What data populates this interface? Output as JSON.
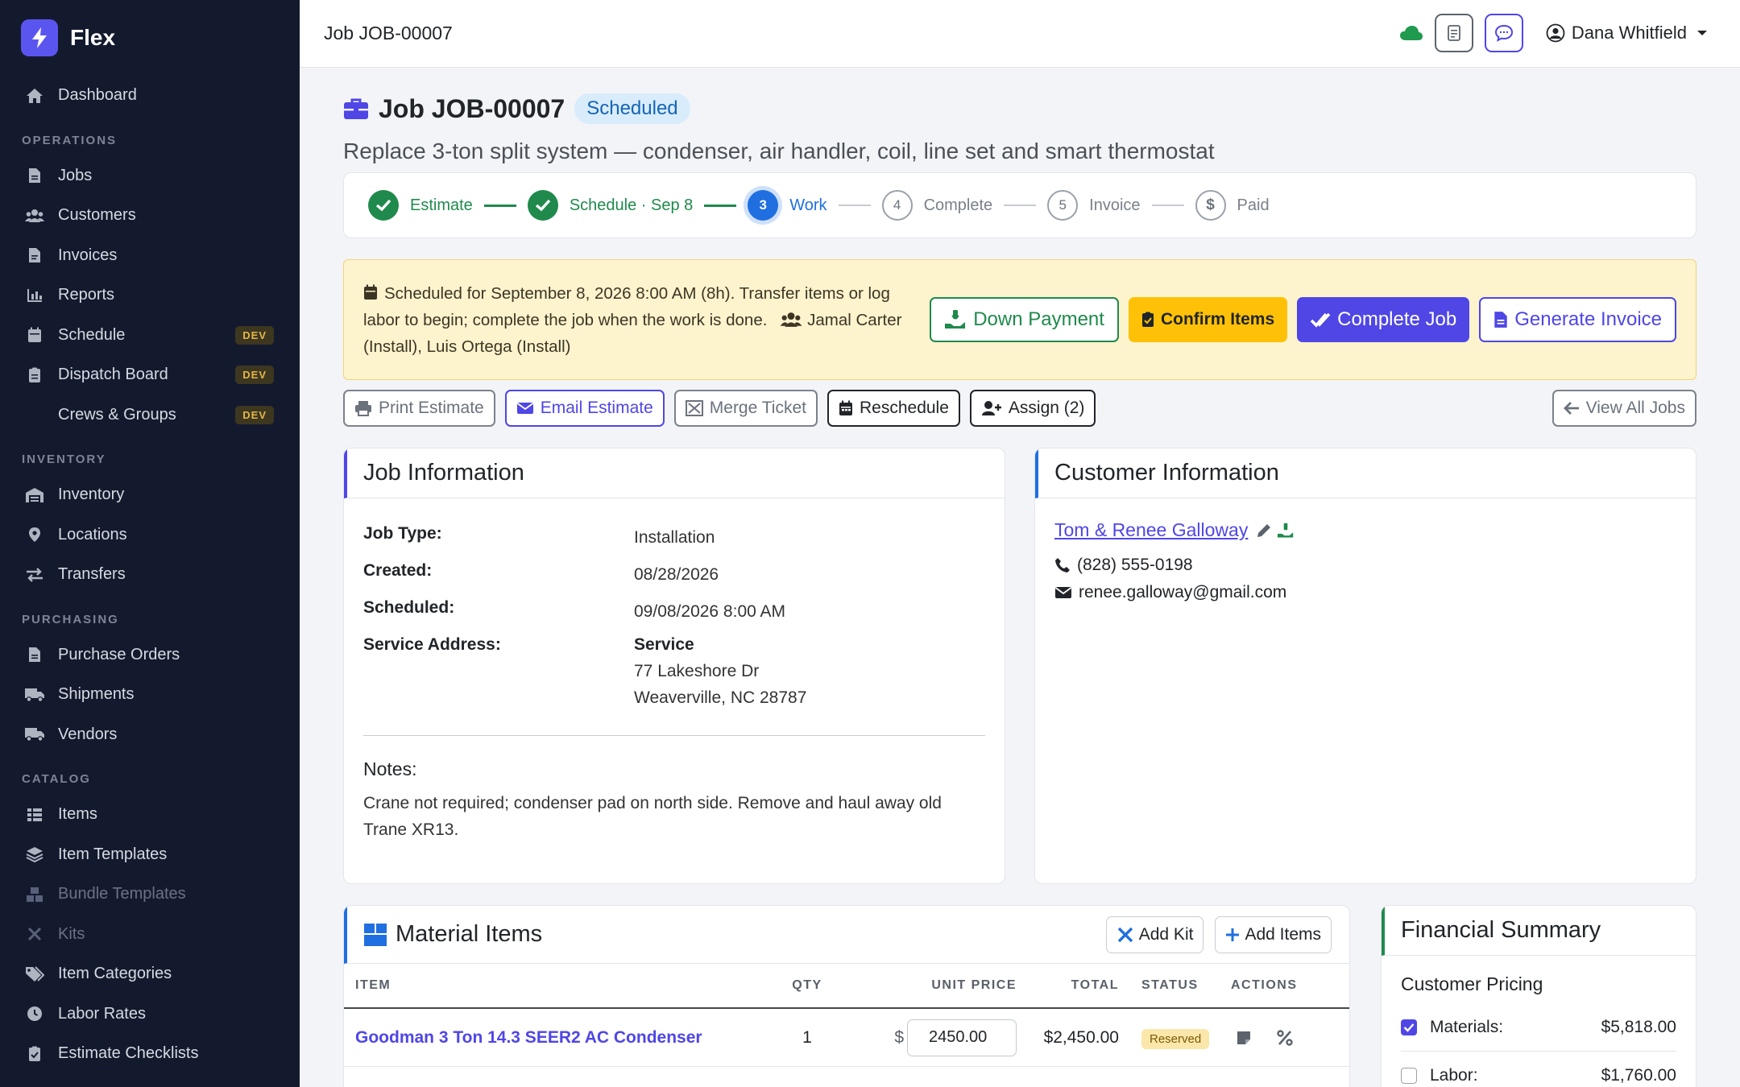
{
  "app": {
    "brand": "Flex"
  },
  "sidebar": {
    "dashboard": "Dashboard",
    "sections": {
      "operations": "OPERATIONS",
      "inventory": "INVENTORY",
      "purchasing": "PURCHASING",
      "catalog": "CATALOG"
    },
    "items": {
      "jobs": "Jobs",
      "customers": "Customers",
      "invoices": "Invoices",
      "reports": "Reports",
      "schedule": "Schedule",
      "dispatch": "Dispatch Board",
      "crews": "Crews & Groups",
      "inventory": "Inventory",
      "locations": "Locations",
      "transfers": "Transfers",
      "purchase_orders": "Purchase Orders",
      "shipments": "Shipments",
      "vendors": "Vendors",
      "items": "Items",
      "item_templates": "Item Templates",
      "bundle_templates": "Bundle Templates",
      "kits": "Kits",
      "item_categories": "Item Categories",
      "labor_rates": "Labor Rates",
      "estimate_checklists": "Estimate Checklists"
    },
    "dev_badge": "DEV"
  },
  "topbar": {
    "title": "Job JOB-00007",
    "user": "Dana Whitfield"
  },
  "job": {
    "title": "Job JOB-00007",
    "status": "Scheduled",
    "description": "Replace 3-ton split system — condenser, air handler, coil, line set and smart thermostat"
  },
  "steps": [
    {
      "num": "1",
      "label": "Estimate",
      "state": "done"
    },
    {
      "num": "2",
      "label": "Schedule · Sep 8",
      "state": "done"
    },
    {
      "num": "3",
      "label": "Work",
      "state": "active"
    },
    {
      "num": "4",
      "label": "Complete",
      "state": "todo"
    },
    {
      "num": "5",
      "label": "Invoice",
      "state": "todo"
    },
    {
      "num": "$",
      "label": "Paid",
      "state": "todo"
    }
  ],
  "alert": {
    "text": "Scheduled for September 8, 2026 8:00 AM (8h). Transfer items or log labor to begin; complete the job when the work is done.",
    "crew": "Jamal Carter (Install), Luis Ortega (Install)",
    "down_payment": "Down Payment",
    "confirm_items": "Confirm Items",
    "complete_job": "Complete Job",
    "generate_invoice": "Generate Invoice"
  },
  "actions": {
    "print_estimate": "Print Estimate",
    "email_estimate": "Email Estimate",
    "merge_ticket": "Merge Ticket",
    "reschedule": "Reschedule",
    "assign": "Assign (2)",
    "view_all": "View All Jobs"
  },
  "job_info": {
    "heading": "Job Information",
    "job_type_label": "Job Type:",
    "job_type": "Installation",
    "created_label": "Created:",
    "created": "08/28/2026",
    "scheduled_label": "Scheduled:",
    "scheduled": "09/08/2026 8:00 AM",
    "address_label": "Service Address:",
    "address_name": "Service",
    "address_line1": "77 Lakeshore Dr",
    "address_line2": "Weaverville, NC 28787",
    "notes_label": "Notes:",
    "notes": "Crane not required; condenser pad on north side. Remove and haul away old Trane XR13."
  },
  "customer_info": {
    "heading": "Customer Information",
    "name": "Tom & Renee Galloway",
    "phone": "(828) 555-0198",
    "email": "renee.galloway@gmail.com"
  },
  "materials": {
    "heading": "Material Items",
    "add_kit": "Add Kit",
    "add_items": "Add Items",
    "columns": {
      "item": "ITEM",
      "qty": "QTY",
      "unit_price": "UNIT PRICE",
      "total": "TOTAL",
      "status": "STATUS",
      "actions": "ACTIONS"
    },
    "rows": [
      {
        "item": "Goodman 3 Ton 14.3 SEER2 AC Condenser",
        "qty": "1",
        "currency": "$",
        "unit_price": "2450.00",
        "total": "$2,450.00",
        "status": "Reserved"
      }
    ]
  },
  "financial": {
    "heading": "Financial Summary",
    "subheading": "Customer Pricing",
    "materials_label": "Materials:",
    "materials_value": "$5,818.00",
    "labor_label": "Labor:",
    "labor_value": "$1,760.00"
  },
  "colors": {
    "brand": "#5b55f0",
    "sidebar": "#141a2e",
    "success": "#1f8a4c",
    "primary": "#4f46e5",
    "info": "#1f6fe0",
    "warning": "#ffc107"
  }
}
